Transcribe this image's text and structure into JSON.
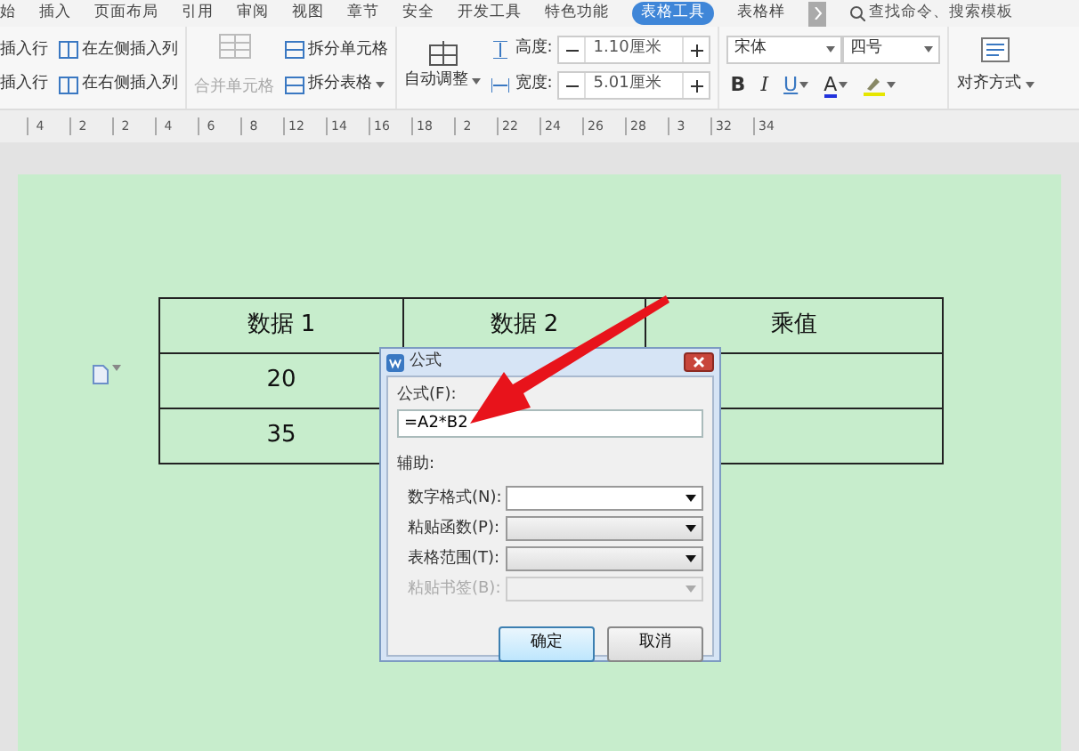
{
  "menu_tabs": [
    {
      "label": "始",
      "selected": false
    },
    {
      "label": "插入",
      "selected": false
    },
    {
      "label": "页面布局",
      "selected": false
    },
    {
      "label": "引用",
      "selected": false
    },
    {
      "label": "审阅",
      "selected": false
    },
    {
      "label": "视图",
      "selected": false
    },
    {
      "label": "章节",
      "selected": false
    },
    {
      "label": "安全",
      "selected": false
    },
    {
      "label": "开发工具",
      "selected": false
    },
    {
      "label": "特色功能",
      "selected": false
    },
    {
      "label": "表格工具",
      "selected": true
    },
    {
      "label": "表格样",
      "selected": false
    }
  ],
  "search": {
    "placeholder": "查找命令、搜索模板"
  },
  "ribbon": {
    "insert_buttons": [
      {
        "label": "插入行"
      },
      {
        "label": "在左侧插入列"
      },
      {
        "label": "插入行"
      },
      {
        "label": "在右侧插入列"
      }
    ],
    "merge_button": {
      "label": "合并单元格",
      "disabled": true
    },
    "split_buttons": [
      {
        "label": "拆分单元格",
        "dropdown": false
      },
      {
        "label": "拆分表格",
        "dropdown": true
      }
    ],
    "autofit_button": {
      "label": "自动调整",
      "dropdown": true
    },
    "size_fields": [
      {
        "label": "高度:",
        "value": "1.10厘米"
      },
      {
        "label": "宽度:",
        "value": "5.01厘米"
      }
    ],
    "font_name": "宋体",
    "font_size": "四号",
    "format_buttons": [
      {
        "label": "B",
        "kind": "bold",
        "dropdown": false
      },
      {
        "label": "I",
        "kind": "italic",
        "dropdown": false
      },
      {
        "label": "U",
        "kind": "underline",
        "dropdown": true
      },
      {
        "label": "A",
        "kind": "color",
        "dropdown": true
      },
      {
        "kind": "highlight",
        "dropdown": true
      }
    ],
    "align_button": {
      "label": "对齐方式",
      "dropdown": true
    }
  },
  "ruler": {
    "numbers": [
      "4",
      "2",
      "2",
      "4",
      "6",
      "8",
      "12",
      "14",
      "16",
      "18",
      "2",
      "22",
      "24",
      "26",
      "28",
      "3",
      "32",
      "34"
    ]
  },
  "table": {
    "rows": [
      [
        "数据 1",
        "数据 2",
        "乘值"
      ],
      [
        "20",
        "",
        ""
      ],
      [
        "35",
        "",
        ""
      ]
    ]
  },
  "dialog": {
    "title": "公式",
    "formula_label": "公式(F):",
    "formula_value": "=A2*B2",
    "section_label": "辅助:",
    "fields": [
      {
        "label": "数字格式(N):",
        "kind": "combo",
        "disabled": false
      },
      {
        "label": "粘贴函数(P):",
        "kind": "list",
        "disabled": false
      },
      {
        "label": "表格范围(T):",
        "kind": "list",
        "disabled": false
      },
      {
        "label": "粘贴书签(B):",
        "kind": "list",
        "disabled": true
      }
    ],
    "buttons": [
      {
        "label": "确定",
        "default": true
      },
      {
        "label": "取消",
        "default": false
      }
    ]
  }
}
